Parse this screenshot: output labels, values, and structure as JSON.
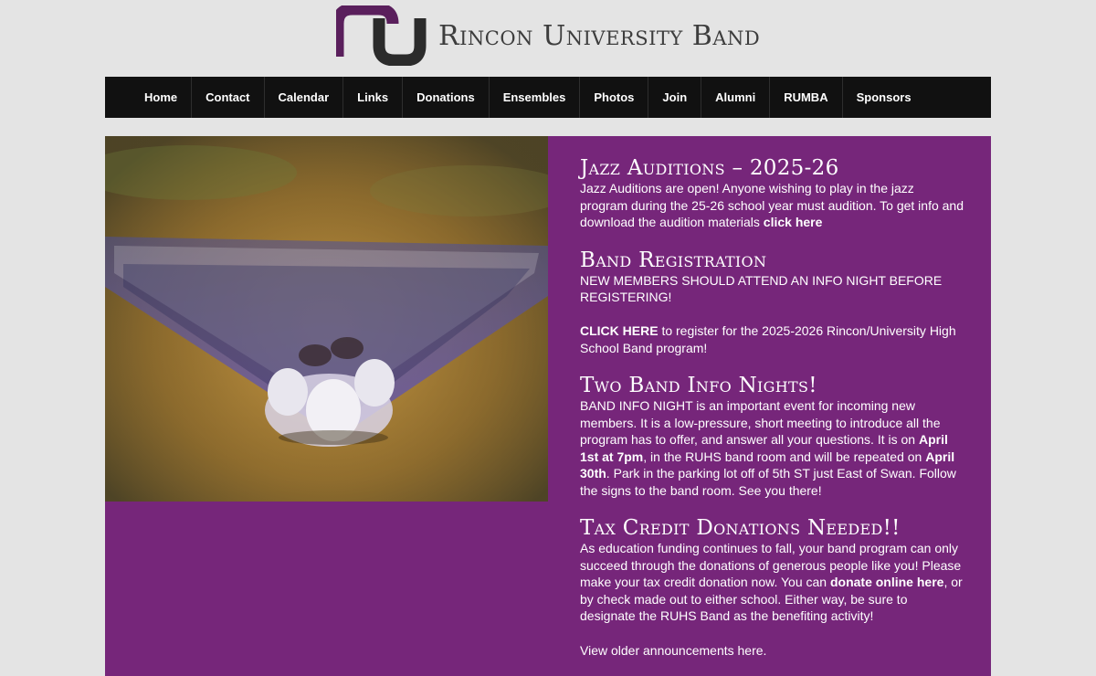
{
  "site": {
    "title": "Rincon University Band",
    "brand_color": "#76267a"
  },
  "nav": {
    "items": [
      "Home",
      "Contact",
      "Calendar",
      "Links",
      "Donations",
      "Ensembles",
      "Photos",
      "Join",
      "Alumni",
      "RUMBA",
      "Sponsors"
    ]
  },
  "hero": {
    "icon": "marching-band-photo"
  },
  "announcements": {
    "jazz": {
      "title": "Jazz Auditions – 2025-26",
      "text": "Jazz Auditions are open! Anyone wishing to play in the jazz program during the 25-26 school year must audition. To get info and download the audition materials ",
      "link": "click here"
    },
    "registration": {
      "title": "Band Registration",
      "notice": "NEW MEMBERS SHOULD ATTEND AN INFO NIGHT BEFORE REGISTERING!",
      "link": "CLICK HERE",
      "text": " to register for the 2025-2026 Rincon/University High School Band program!"
    },
    "info_nights": {
      "title": "Two Band Info Nights!",
      "text1": "BAND INFO NIGHT is an important event for incoming new members. It is a low-pressure, short meeting to introduce all the program has to offer, and answer all your questions. It is on ",
      "date1": "April 1st at 7pm",
      "text2": ", in the RUHS band room and will be repeated on ",
      "date2": "April 30th",
      "text3": ". Park in the parking lot off of 5th ST just East of Swan. Follow the signs to the band room. See you there!"
    },
    "tax_credit": {
      "title": "Tax Credit Donations Needed!!",
      "text1": "As education funding continues to fall, your band program can only succeed through the donations of generous people like you! Please make your tax credit donation now. You can ",
      "link": "donate online here",
      "text2": ", or by check made out to either school. Either way, be sure to designate the RUHS Band as the benefiting activity!"
    },
    "older": "View older announcements here."
  }
}
